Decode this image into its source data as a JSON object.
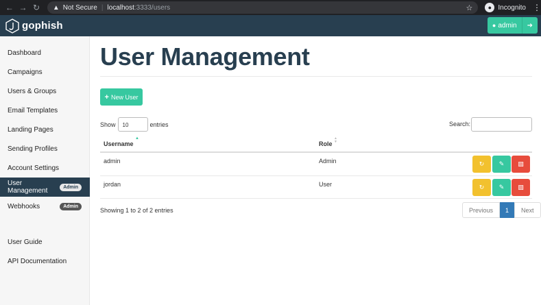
{
  "browser": {
    "security_warning": "Not Secure",
    "url_host": "localhost",
    "url_path": ":3333/users",
    "profile_label": "Incognito"
  },
  "app": {
    "brand": "gophish",
    "user_label": "admin"
  },
  "sidebar": {
    "items": [
      {
        "label": "Dashboard"
      },
      {
        "label": "Campaigns"
      },
      {
        "label": "Users & Groups"
      },
      {
        "label": "Email Templates"
      },
      {
        "label": "Landing Pages"
      },
      {
        "label": "Sending Profiles"
      },
      {
        "label": "Account Settings"
      },
      {
        "label": "User Management",
        "badge": "Admin",
        "active": true
      },
      {
        "label": "Webhooks",
        "badge": "Admin"
      }
    ],
    "footer_items": [
      {
        "label": "User Guide"
      },
      {
        "label": "API Documentation"
      }
    ]
  },
  "main": {
    "title": "User Management",
    "new_user_label": "New User",
    "show_label": "Show",
    "entries_value": "10",
    "entries_label": "entries",
    "search_label": "Search:",
    "columns": [
      "Username",
      "Role"
    ],
    "rows": [
      {
        "username": "admin",
        "role": "Admin"
      },
      {
        "username": "jordan",
        "role": "User"
      }
    ],
    "info": "Showing 1 to 2 of 2 entries",
    "pagination": {
      "previous": "Previous",
      "current": "1",
      "next": "Next"
    }
  },
  "colors": {
    "header_bg": "#283f50",
    "accent": "#37c8a0",
    "warning": "#f2c12e",
    "danger": "#e74c3c",
    "page_active": "#337ab7"
  }
}
